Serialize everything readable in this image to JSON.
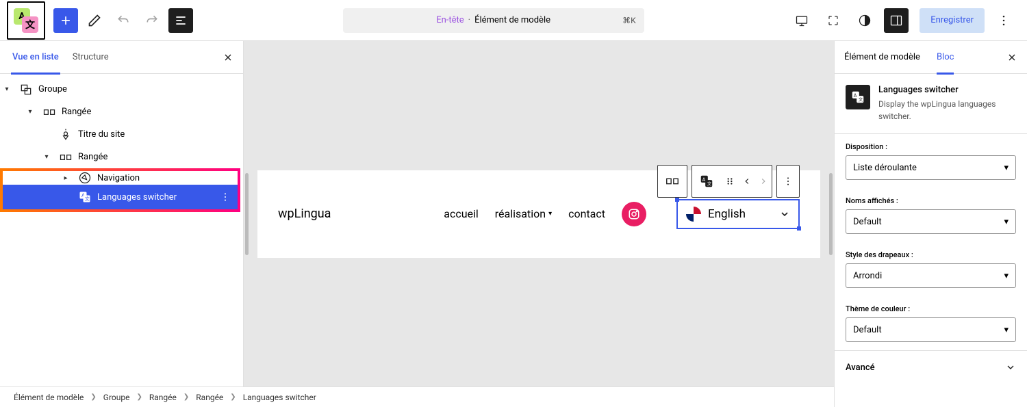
{
  "toolbar": {
    "doc_prefix": "En-tête",
    "doc_separator": "·",
    "doc_suffix": "Élément de modèle",
    "shortcut": "⌘K",
    "save": "Enregistrer"
  },
  "left_panel": {
    "tab_list": "Vue en liste",
    "tab_structure": "Structure",
    "tree": {
      "groupe": "Groupe",
      "rangee1": "Rangée",
      "titre": "Titre du site",
      "rangee2": "Rangée",
      "navigation": "Navigation",
      "lang_switcher": "Languages switcher"
    }
  },
  "canvas": {
    "site_title": "wpLingua",
    "nav": {
      "accueil": "accueil",
      "realisation": "réalisation",
      "contact": "contact"
    },
    "switcher_lang": "English"
  },
  "right_panel": {
    "tab_element": "Élément de modèle",
    "tab_bloc": "Bloc",
    "block_title": "Languages switcher",
    "block_desc": "Display the wpLingua languages switcher.",
    "disposition_label": "Disposition :",
    "disposition_value": "Liste déroulante",
    "noms_label": "Noms affichés :",
    "noms_value": "Default",
    "drapeaux_label": "Style des drapeaux :",
    "drapeaux_value": "Arrondi",
    "theme_label": "Thème de couleur :",
    "theme_value": "Default",
    "advanced": "Avancé"
  },
  "breadcrumb": {
    "b1": "Élément de modèle",
    "b2": "Groupe",
    "b3": "Rangée",
    "b4": "Rangée",
    "b5": "Languages switcher"
  }
}
